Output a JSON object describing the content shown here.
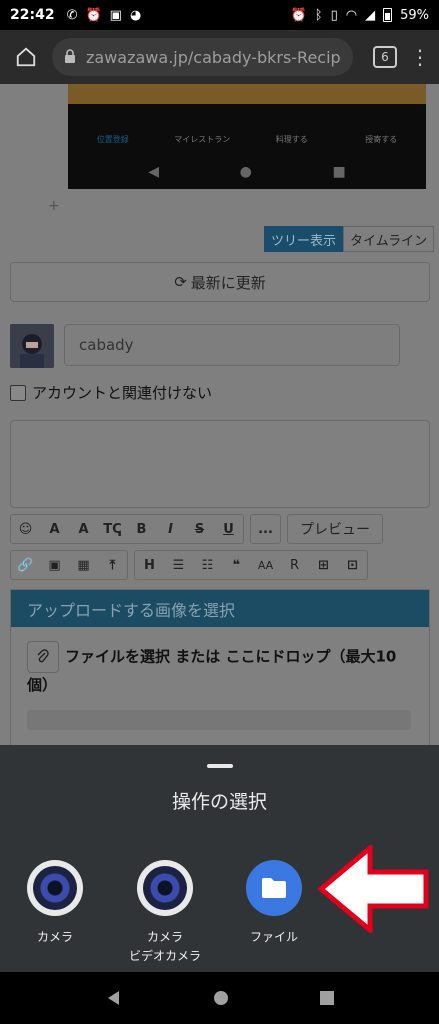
{
  "status_bar": {
    "time": "22:42",
    "battery": "59%",
    "left_icons": [
      "phone-icon",
      "alarm-icon",
      "notification-icon",
      "app-icon"
    ],
    "right_icons": [
      "alarm-icon",
      "bluetooth-icon",
      "vibrate-icon",
      "wifi-icon",
      "signal-icon",
      "battery-icon"
    ]
  },
  "browser": {
    "url": "zawazawa.jp/cabady-bkrs-Recip",
    "tab_count": "6"
  },
  "embedded_screenshot": {
    "nav": [
      "位置登録",
      "マイレストラン",
      "料理する",
      "授寄する"
    ]
  },
  "page": {
    "view_tabs": [
      "ツリー表示",
      "タイムライン"
    ],
    "active_view_tab": "ツリー表示",
    "refresh_label": "最新に更新",
    "name_value": "cabady",
    "checkbox_label": "アカウントと関連付けない",
    "toolbar_row1": [
      "☺",
      "A",
      "A",
      "Tↅ",
      "B",
      "I",
      "S",
      "U",
      "...",
      "プレビュー"
    ],
    "toolbar_row2": [
      "🔗",
      "▣",
      "▦",
      "⤒",
      "H",
      "☰",
      "☷",
      "❝",
      "AA",
      "R",
      "⊞",
      "⊡"
    ],
    "upload_header": "アップロードする画像を選択",
    "upload_text": "ファイルを選択 または ここにドロップ（最大10個）"
  },
  "sheet": {
    "title": "操作の選択",
    "apps": [
      {
        "label": "カメラ",
        "sub": ""
      },
      {
        "label": "カメラ",
        "sub": "ビデオカメラ"
      },
      {
        "label": "ファイル",
        "sub": ""
      }
    ]
  },
  "colors": {
    "sheet_bg": "#303437",
    "files_blue": "#3c78e1",
    "arrow_red": "#e4001b"
  }
}
